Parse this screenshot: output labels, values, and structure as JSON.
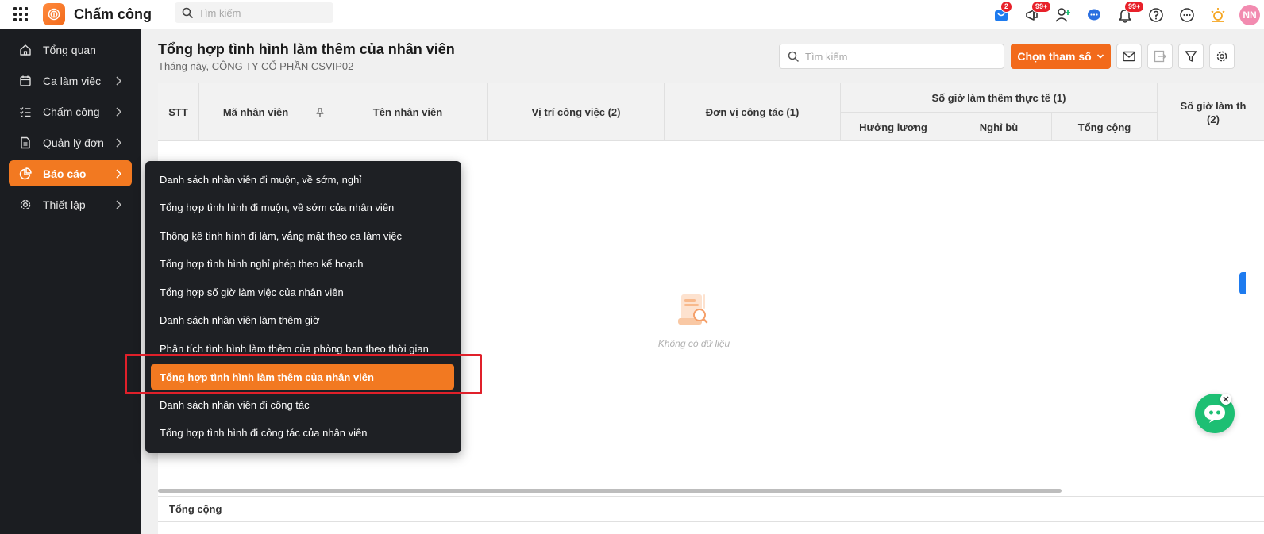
{
  "app": {
    "title": "Chấm công",
    "search_placeholder": "Tìm kiếm",
    "badges": {
      "store": "2",
      "announcements": "99+",
      "notifications": "99+"
    },
    "user_initials": "NN"
  },
  "sidebar": {
    "items": [
      {
        "label": "Tổng quan",
        "icon": "home-icon",
        "has_chevron": false
      },
      {
        "label": "Ca làm việc",
        "icon": "calendar-icon",
        "has_chevron": true
      },
      {
        "label": "Chấm công",
        "icon": "checklist-icon",
        "has_chevron": true
      },
      {
        "label": "Quản lý đơn",
        "icon": "document-icon",
        "has_chevron": true
      },
      {
        "label": "Báo cáo",
        "icon": "pie-chart-icon",
        "has_chevron": true,
        "active": true
      },
      {
        "label": "Thiết lập",
        "icon": "gear-icon",
        "has_chevron": true
      }
    ]
  },
  "page": {
    "title": "Tổng hợp tình hình làm thêm của nhân viên",
    "subtitle": "Tháng này, CÔNG TY CỔ PHẦN CSVIP02",
    "search_placeholder": "Tìm kiếm",
    "params_button": "Chọn tham số"
  },
  "table": {
    "headers": {
      "stt": "STT",
      "employee_id": "Mã nhân viên",
      "employee_name": "Tên nhân viên",
      "position": "Vị trí công việc (2)",
      "unit": "Đơn vị công tác (1)",
      "actual_ot_group": "Số giờ làm thêm thực tế (1)",
      "paid": "Hưởng lương",
      "comp_leave": "Nghỉ bù",
      "total": "Tổng cộng",
      "next_group_line1": "Số giờ làm th",
      "next_group_line2": "(2)"
    },
    "empty_text": "Không có dữ liệu",
    "footer_label": "Tổng cộng"
  },
  "report_menu": {
    "items": [
      {
        "label": "Danh sách nhân viên đi muộn, về sớm, nghỉ"
      },
      {
        "label": "Tổng hợp tình hình đi muộn, về sớm của nhân viên"
      },
      {
        "label": "Thống kê tình hình đi làm, vắng mặt theo ca làm việc"
      },
      {
        "label": "Tổng hợp tình hình nghỉ phép theo kế hoạch"
      },
      {
        "label": "Tổng hợp số giờ làm việc của nhân viên"
      },
      {
        "label": "Danh sách nhân viên làm thêm giờ"
      },
      {
        "label": "Phân tích tình hình làm thêm của phòng ban theo thời gian"
      },
      {
        "label": "Tổng hợp tình hình làm thêm của nhân viên",
        "active": true
      },
      {
        "label": "Danh sách nhân viên đi công tác"
      },
      {
        "label": "Tổng hợp tình hình đi công tác của nhân viên"
      }
    ]
  },
  "colors": {
    "accent": "#f26a1b",
    "sidebar_bg": "#1b1d21",
    "highlight": "#e0202a",
    "chatbot": "#1dbf73"
  }
}
